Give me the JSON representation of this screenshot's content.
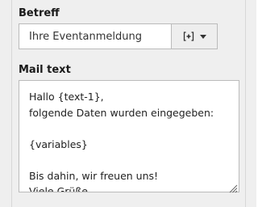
{
  "subject": {
    "label": "Betreff",
    "value": "Ihre Eventanmeldung",
    "addon_icon": "bracket-plus-icon",
    "addon_caret": "caret-down-icon"
  },
  "mail_text": {
    "label": "Mail text",
    "value": "Hallo {text-1},\nfolgende Daten wurden eingegeben:\n\n{variables}\n\nBis dahin, wir freuen uns!\nViele Grüße"
  }
}
